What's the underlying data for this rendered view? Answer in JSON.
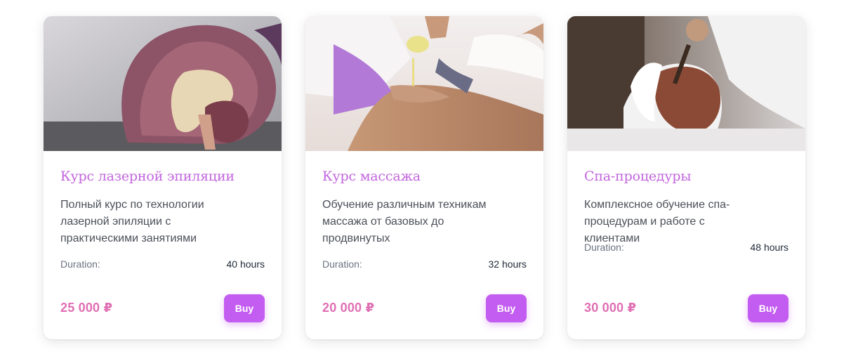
{
  "cards": [
    {
      "title": "Курс лазерной эпиляции",
      "description": "Полный курс по технологии лазерной эпиляции с практическими занятиями",
      "duration_label": "Duration:",
      "duration_value": "40 hours",
      "price": "25 000 ₽",
      "buy_label": "Buy",
      "image": "brain-anatomy-model-photo"
    },
    {
      "title": "Курс массажа",
      "description": "Обучение различным техникам массажа от базовых до продвинутых",
      "duration_label": "Duration:",
      "duration_value": "32 hours",
      "price": "20 000 ₽",
      "buy_label": "Buy",
      "image": "oil-massage-photo"
    },
    {
      "title": "Спа-процедуры",
      "description": "Комплексное обучение спа-процедурам и работе с клиентами",
      "duration_label": "Duration:",
      "duration_value": "48 hours",
      "price": "30 000 ₽",
      "buy_label": "Buy",
      "image": "facial-mask-spa-photo"
    }
  ],
  "colors": {
    "title": "#c264dd",
    "price": "#e06fb3",
    "button": "#c35cf0"
  }
}
